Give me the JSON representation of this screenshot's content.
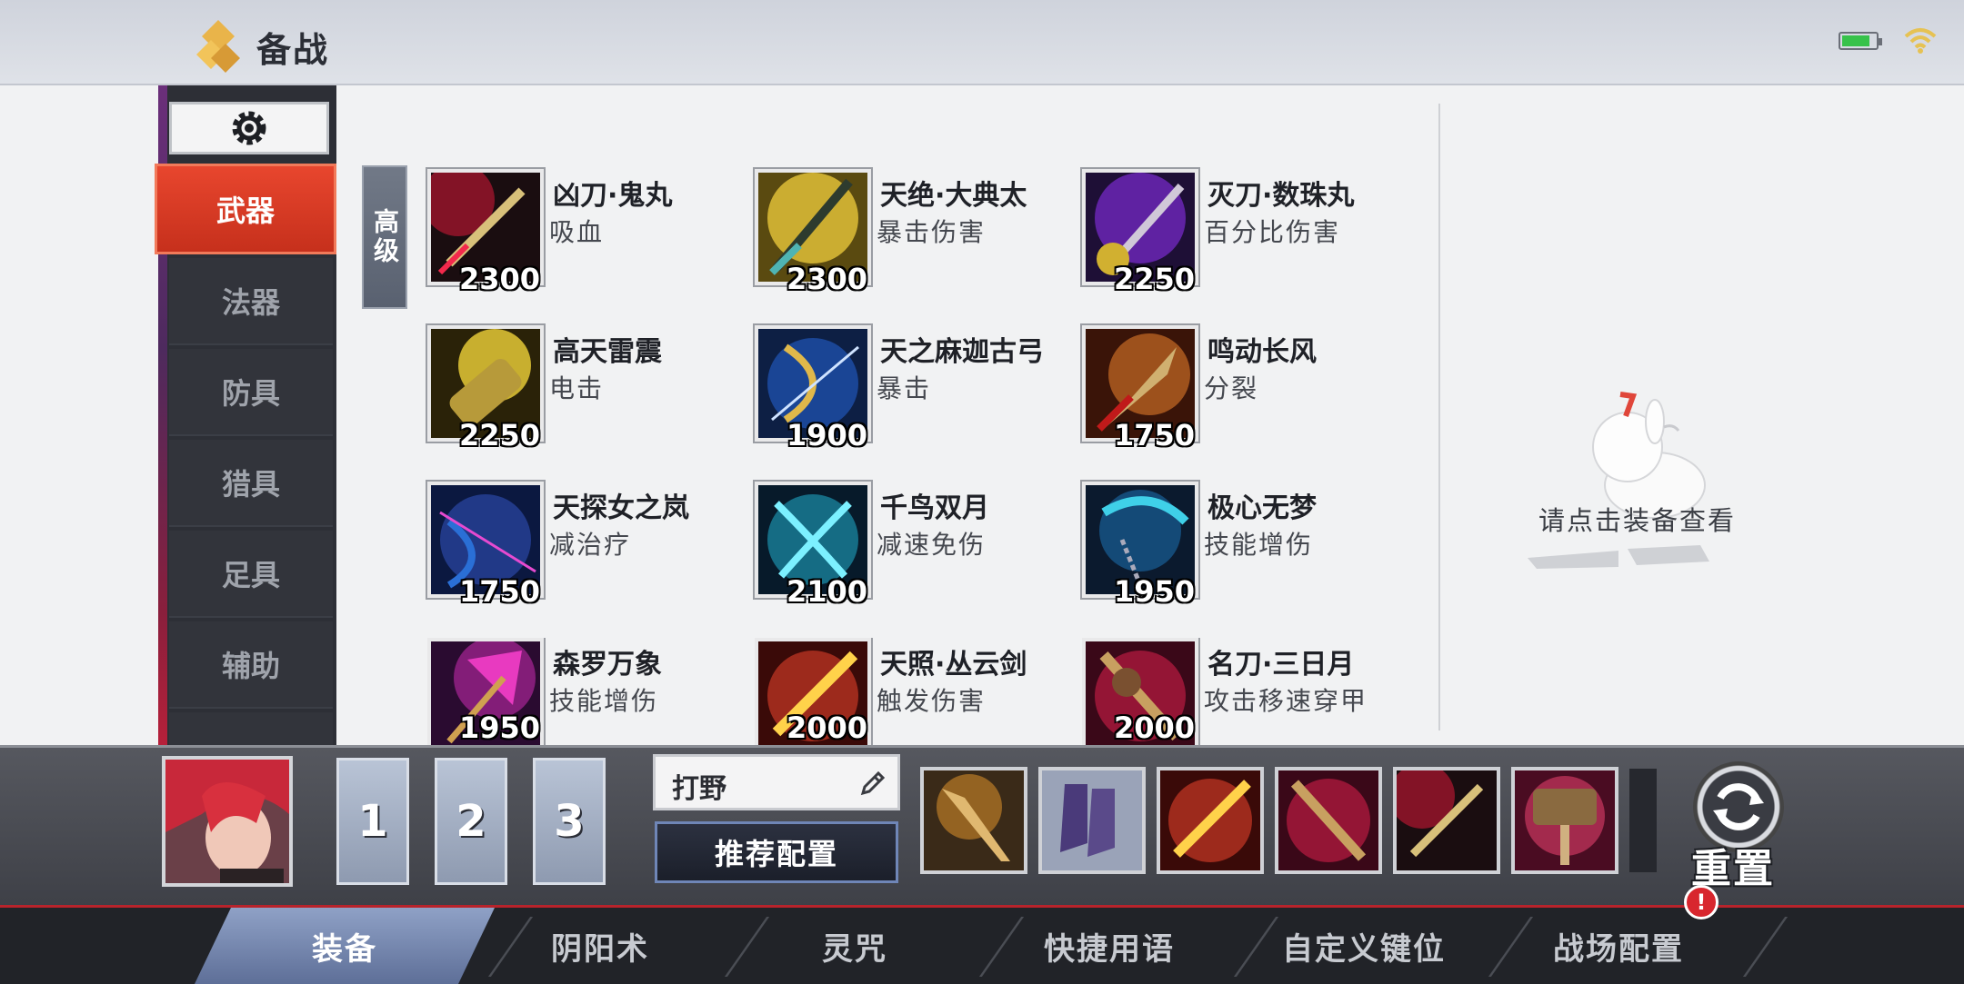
{
  "header": {
    "title": "备战"
  },
  "sidebar": {
    "categories": [
      {
        "label": "武器",
        "active": true
      },
      {
        "label": "法器",
        "active": false
      },
      {
        "label": "防具",
        "active": false
      },
      {
        "label": "猎具",
        "active": false
      },
      {
        "label": "足具",
        "active": false
      },
      {
        "label": "辅助",
        "active": false
      }
    ],
    "tier_tab": "高级"
  },
  "items": [
    {
      "name": "凶刀·鬼丸",
      "effect": "吸血",
      "price": "2300"
    },
    {
      "name": "天绝·大典太",
      "effect": "暴击伤害",
      "price": "2300"
    },
    {
      "name": "灭刀·数珠丸",
      "effect": "百分比伤害",
      "price": "2250"
    },
    {
      "name": "高天雷震",
      "effect": "电击",
      "price": "2250"
    },
    {
      "name": "天之麻迦古弓",
      "effect": "暴击",
      "price": "1900"
    },
    {
      "name": "鸣动长风",
      "effect": "分裂",
      "price": "1750"
    },
    {
      "name": "天探女之岚",
      "effect": "减治疗",
      "price": "1750"
    },
    {
      "name": "千鸟双月",
      "effect": "减速免伤",
      "price": "2100"
    },
    {
      "name": "极心无梦",
      "effect": "技能增伤",
      "price": "1950"
    },
    {
      "name": "森罗万象",
      "effect": "技能增伤",
      "price": "1950"
    },
    {
      "name": "天照·丛云剑",
      "effect": "触发伤害",
      "price": "2000"
    },
    {
      "name": "名刀·三日月",
      "effect": "攻击移速穿甲",
      "price": "2000"
    }
  ],
  "detail": {
    "hint": "请点击装备查看"
  },
  "loadout": {
    "slots": [
      "1",
      "2",
      "3"
    ],
    "role": "打野",
    "recommend_label": "推荐配置",
    "reset_label": "重置"
  },
  "nav": {
    "tabs": [
      {
        "label": "装备",
        "active": true
      },
      {
        "label": "阴阳术",
        "active": false
      },
      {
        "label": "灵咒",
        "active": false
      },
      {
        "label": "快捷用语",
        "active": false
      },
      {
        "label": "自定义键位",
        "active": false
      },
      {
        "label": "战场配置",
        "active": false
      }
    ],
    "alert_badge": "!"
  },
  "colors": {
    "accent_red": "#d8362a",
    "nav_active": "#7688b3"
  }
}
